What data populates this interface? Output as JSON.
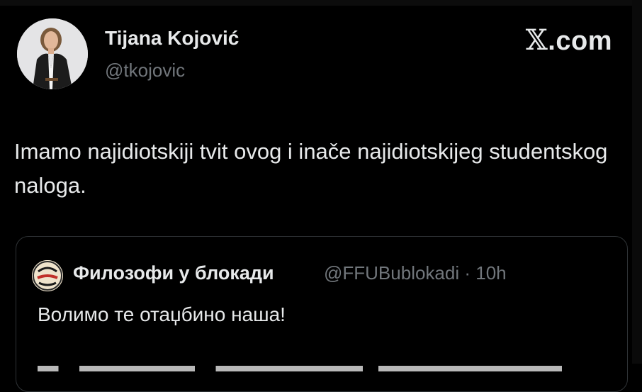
{
  "tweet": {
    "author": {
      "name": "Tijana Kojović",
      "handle": "@tkojovic",
      "avatar_icon": "profile-photo"
    },
    "site_label": {
      "glyph": "𝕏",
      "suffix": ".com"
    },
    "text": "Imamo najidiotskiji tvit ovog i inače najidiotskijeg studentskog naloga.",
    "quote": {
      "author_name": "Филозофи у блокади",
      "author_handle": "@FFUBublokadi",
      "time": "· 10h",
      "avatar_icon": "filozofi-blokada-logo",
      "text": "Волимо те отаџбино наша!"
    }
  },
  "colors": {
    "background": "#000000",
    "primary_text": "#e7e9ea",
    "secondary_text": "#71767b",
    "card_border": "#2f3336"
  }
}
